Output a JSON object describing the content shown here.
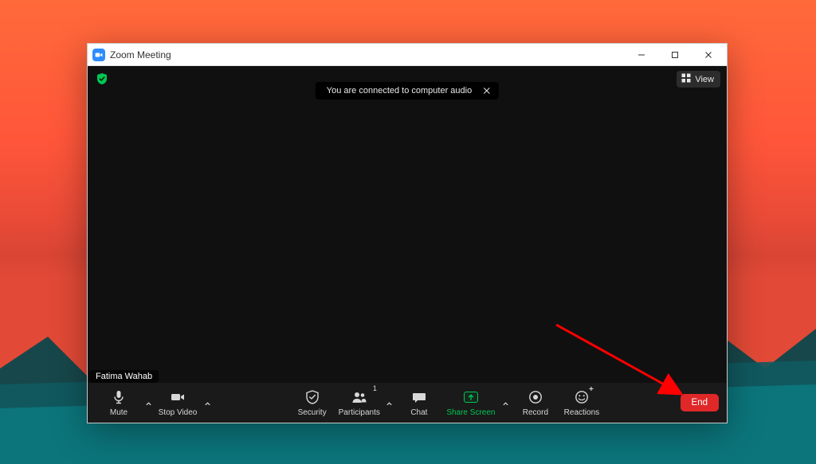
{
  "window": {
    "title": "Zoom Meeting"
  },
  "view_button": {
    "label": "View"
  },
  "toast": {
    "message": "You are connected to computer audio"
  },
  "participant_name": "Fatima Wahab",
  "toolbar": {
    "mute": "Mute",
    "stop_video": "Stop Video",
    "security": "Security",
    "participants": "Participants",
    "participants_count": "1",
    "chat": "Chat",
    "share_screen": "Share Screen",
    "record": "Record",
    "reactions": "Reactions",
    "end": "End"
  }
}
